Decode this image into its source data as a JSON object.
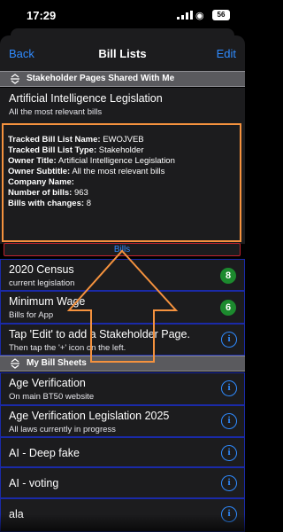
{
  "status": {
    "time": "17:29",
    "battery": "56"
  },
  "nav": {
    "back": "Back",
    "title": "Bill Lists",
    "edit": "Edit"
  },
  "sections": {
    "shared": "Stakeholder Pages Shared With Me",
    "my": "My Bill Sheets"
  },
  "shared_header": {
    "title": "Artificial Intelligence Legislation",
    "subtitle": "All the most relevant bills"
  },
  "details": {
    "name_label": "Tracked Bill List Name:",
    "name_value": "EWOJVEB",
    "type_label": "Tracked Bill List Type:",
    "type_value": "Stakeholder",
    "owner_title_label": "Owner Title:",
    "owner_title_value": "Artificial Intelligence Legislation",
    "owner_subtitle_label": "Owner Subtitle:",
    "owner_subtitle_value": "All the most relevant bills",
    "company_label": "Company Name:",
    "company_value": "",
    "count_label": "Number of bills:",
    "count_value": "963",
    "changes_label": "Bills with changes:",
    "changes_value": "8"
  },
  "bills_button": "Bills",
  "shared_rows": [
    {
      "title": "2020 Census",
      "subtitle": "current legislation",
      "badge": "8"
    },
    {
      "title": "Minimum Wage",
      "subtitle": "Bills for App",
      "badge": "6"
    },
    {
      "title": "Tap 'Edit' to add a Stakeholder Page.",
      "subtitle": "Then tap the '+' icon on the left.",
      "info": "i"
    }
  ],
  "my_rows": [
    {
      "title": "Age Verification",
      "subtitle": "On main BT50 website",
      "info": "i"
    },
    {
      "title": "Age Verification Legislation 2025",
      "subtitle": "All laws currently in progress",
      "info": "i"
    },
    {
      "title": "AI - Deep fake",
      "info": "i"
    },
    {
      "title": "AI - voting",
      "info": "i"
    },
    {
      "title": "ala",
      "info": "i"
    }
  ],
  "colors": {
    "accent": "#2f8bff",
    "highlight": "#f5923e",
    "badge": "#1c8a2e",
    "row_border": "#1a2aa8"
  },
  "icons": {
    "section": "sort-arrows-icon",
    "arrow": "up-arrow-annotation"
  }
}
